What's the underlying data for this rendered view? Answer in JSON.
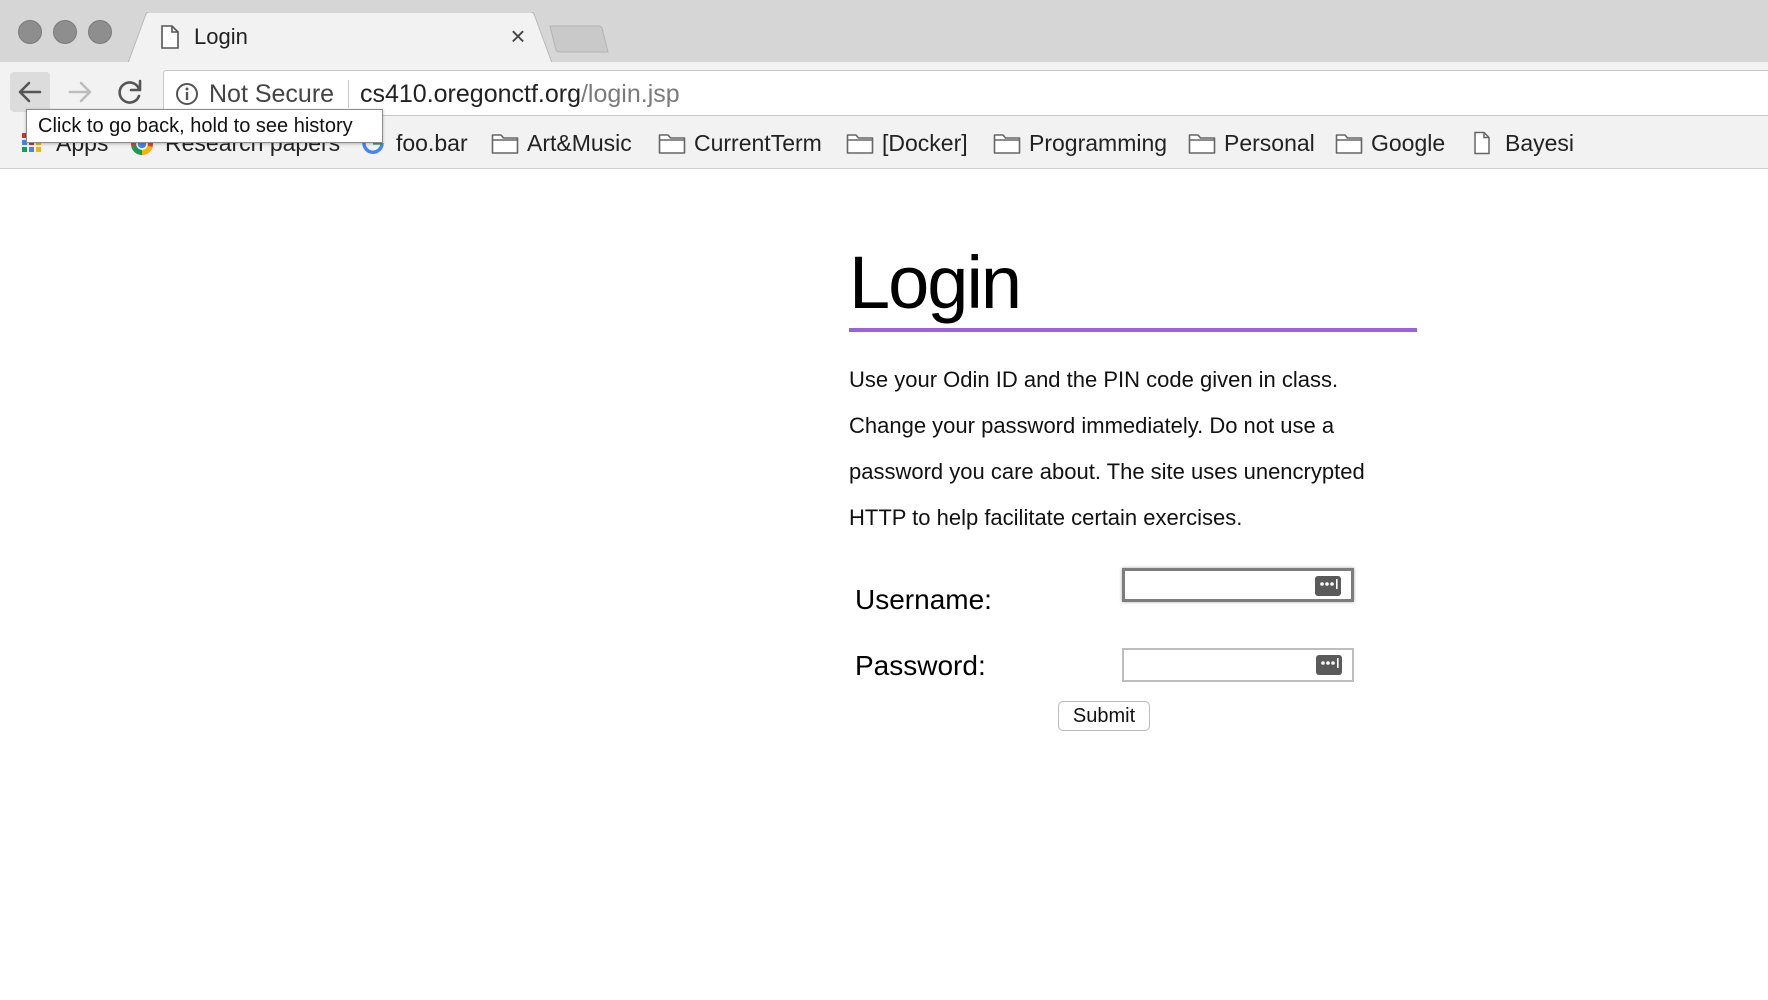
{
  "browser": {
    "tab": {
      "title": "Login",
      "icon": "document-icon",
      "close_glyph": "×"
    },
    "toolbar": {
      "security_label": "Not Secure",
      "url_host": "cs410.oregonctf.org",
      "url_path": "/login.jsp"
    },
    "bookmarks": [
      {
        "label": "Apps",
        "icon": "apps-grid-icon"
      },
      {
        "label": "Research papers",
        "icon": "chrome-icon"
      },
      {
        "label": "foo.bar",
        "icon": "google-icon"
      },
      {
        "label": "Art&Music",
        "icon": "folder-icon"
      },
      {
        "label": "CurrentTerm",
        "icon": "folder-icon"
      },
      {
        "label": "[Docker]",
        "icon": "folder-icon"
      },
      {
        "label": "Programming",
        "icon": "folder-icon"
      },
      {
        "label": "Personal",
        "icon": "folder-icon"
      },
      {
        "label": "Google",
        "icon": "folder-icon"
      },
      {
        "label": "Bayesi",
        "icon": "document-icon"
      }
    ],
    "tooltip": "Click to go back, hold to see history"
  },
  "page": {
    "title": "Login",
    "accent_color": "#9b63d9",
    "intro_lines": [
      "Use your Odin ID and the PIN code given in class.",
      "Change your password immediately. Do not use a",
      "password you care about. The site uses unencrypted",
      "HTTP to help facilitate certain exercises."
    ],
    "form": {
      "username_label": "Username:",
      "username_value": "",
      "password_label": "Password:",
      "password_value": "",
      "submit_label": "Submit"
    }
  }
}
